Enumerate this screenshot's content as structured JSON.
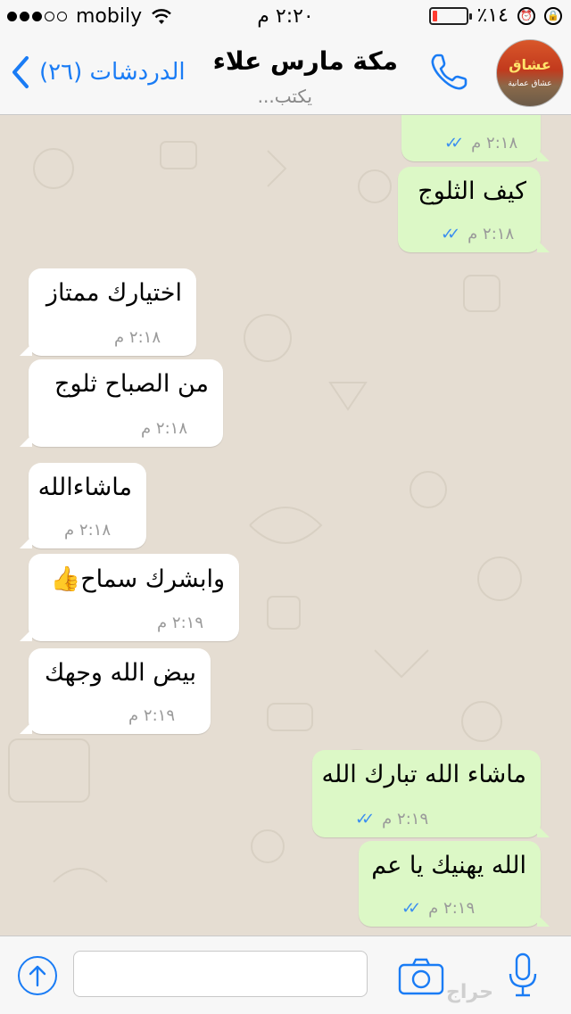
{
  "status_bar": {
    "carrier": "mobily",
    "signal_dots_filled": 3,
    "signal_dots_total": 5,
    "time": "٢:٢٠ م",
    "battery_label": "٪١٤",
    "battery_fraction": 0.14,
    "icons": [
      "wifi-icon",
      "rotation-lock-icon",
      "alarm-icon",
      "battery-icon"
    ]
  },
  "nav": {
    "back_label": "الدردشات (٢٦)",
    "contact_name": "مكة مارس علاء",
    "typing_status": "يكتب...",
    "avatar_text": "عشاق",
    "avatar_subtext": "عشاق عمانية",
    "accent_color": "#1a7cf5"
  },
  "messages": [
    {
      "dir": "out",
      "text": "",
      "time": "٢:١٨ م",
      "read": true
    },
    {
      "dir": "out",
      "text": "كيف الثلوج",
      "time": "٢:١٨ م",
      "read": true
    },
    {
      "dir": "in",
      "text": "اختيارك ممتاز",
      "time": "٢:١٨ م"
    },
    {
      "dir": "in",
      "text": "من الصباح ثلوج",
      "time": "٢:١٨ م"
    },
    {
      "dir": "in",
      "text": "ماشاءالله",
      "time": "٢:١٨ م"
    },
    {
      "dir": "in",
      "text": "وابشرك سماح",
      "emoji": "👍",
      "time": "٢:١٩ م"
    },
    {
      "dir": "in",
      "text": "بيض الله وجهك",
      "time": "٢:١٩ م"
    },
    {
      "dir": "out",
      "text": "ماشاء الله تبارك الله",
      "time": "٢:١٩ م",
      "read": true
    },
    {
      "dir": "out",
      "text": "الله يهنيك يا عم",
      "time": "٢:١٩ م",
      "read": true
    }
  ],
  "read_ticks": "✓✓",
  "input": {
    "placeholder": "",
    "watermark": "حراج"
  },
  "colors": {
    "outgoing_bubble": "#dcf8c6",
    "incoming_bubble": "#ffffff",
    "read_tick": "#3b8ef0",
    "battery_low": "#ff3b30"
  }
}
